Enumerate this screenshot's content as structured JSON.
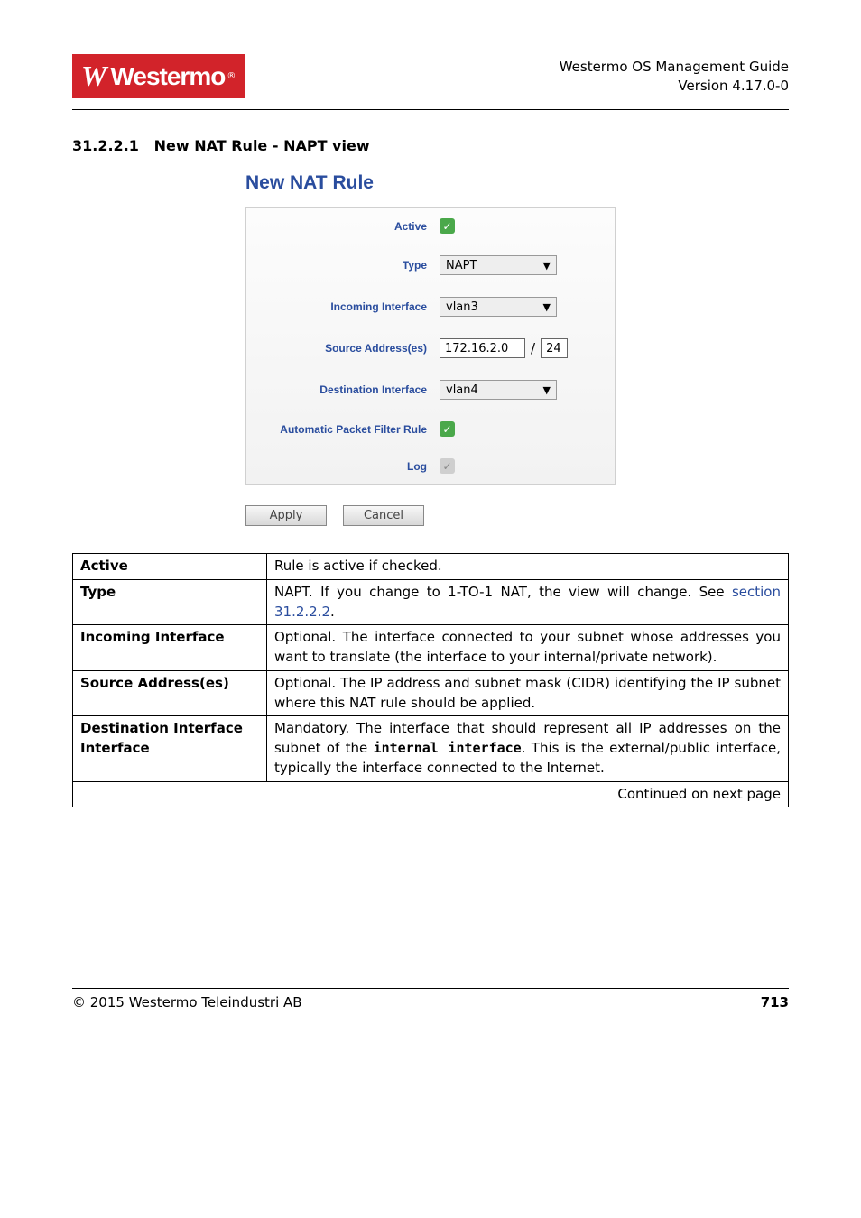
{
  "header": {
    "guide_title": "Westermo OS Management Guide",
    "version": "Version 4.17.0-0"
  },
  "section": {
    "number": "31.2.2.1",
    "title": "New NAT Rule - NAPT view"
  },
  "dialog": {
    "title": "New NAT Rule",
    "labels": {
      "active": "Active",
      "type": "Type",
      "incoming_interface": "Incoming Interface",
      "source_addresses": "Source Address(es)",
      "destination_interface": "Destination Interface",
      "auto_pf_rule": "Automatic Packet Filter Rule",
      "log": "Log"
    },
    "values": {
      "active_checked": true,
      "type_selected": "NAPT",
      "incoming_interface": "vlan3",
      "source_ip": "172.16.2.0",
      "source_slash": "/",
      "source_mask": "24",
      "destination_interface": "vlan4",
      "auto_pf_checked": true,
      "log_checked": false
    },
    "buttons": {
      "apply": "Apply",
      "cancel": "Cancel"
    }
  },
  "desc_table": {
    "rows": [
      {
        "label": "Active",
        "text": "Rule is active if checked."
      },
      {
        "label": "Type",
        "text_pre": "NAPT. If you change to 1-TO-1 NAT, the view will change. See ",
        "link": "section 31.2.2.2",
        "text_post": "."
      },
      {
        "label": "Incoming Interface",
        "text": "Optional. The interface connected to your subnet whose addresses you want to translate (the interface to your internal/private network)."
      },
      {
        "label": "Source Address(es)",
        "text": "Optional. The IP address and subnet mask (CIDR) identifying the IP subnet where this NAT rule should be applied."
      },
      {
        "label": "Destination Interface",
        "text_pre": "Mandatory.  The interface that should represent all IP addresses on the subnet of the ",
        "mono1": "internal interface",
        "text_mid": ". This is the external/public interface, typically the interface connected to the Internet."
      }
    ],
    "continued": "Continued on next page"
  },
  "footer": {
    "copyright": "© 2015 Westermo Teleindustri AB",
    "page_number": "713"
  }
}
